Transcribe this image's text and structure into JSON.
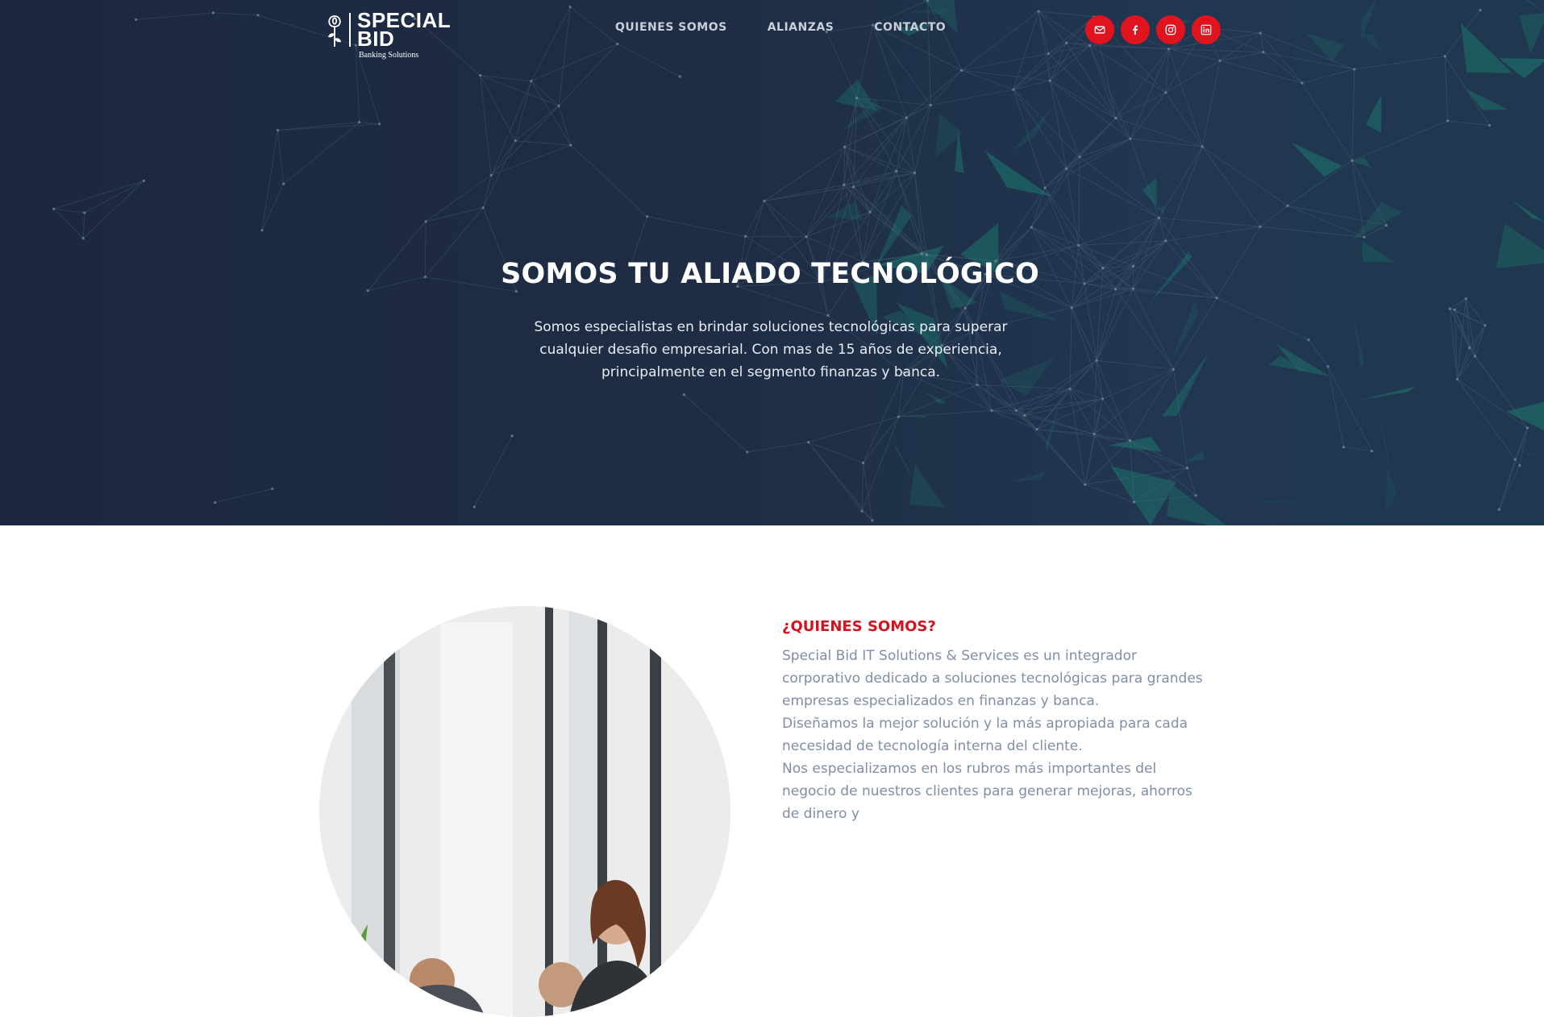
{
  "brand": {
    "logo_line1": "SPECIAL",
    "logo_line2": "BID",
    "logo_sub": "Banking Solutions"
  },
  "nav": {
    "items": [
      "QUIENES SOMOS",
      "ALIANZAS",
      "CONTACTO"
    ]
  },
  "social": {
    "icons": [
      "mail-icon",
      "facebook-icon",
      "instagram-icon",
      "linkedin-icon"
    ],
    "color": "#e0131f"
  },
  "hero": {
    "title": "SOMOS TU ALIADO TECNOLÓGICO",
    "text": "Somos especialistas en brindar soluciones tecnológicas para superar cualquier desafio empresarial. Con mas de 15 años de experiencia, principalmente en el segmento finanzas y banca."
  },
  "about": {
    "heading": "¿QUIENES SOMOS?",
    "paragraphs": [
      "Special Bid IT Solutions & Services es un integrador corporativo dedicado a soluciones tecnológicas para grandes empresas especializados en finanzas y banca.",
      "Diseñamos la mejor solución y la más apropiada para cada necesidad de tecnología interna del cliente.",
      "Nos especializamos en los rubros más importantes del negocio de nuestros clientes para generar mejoras, ahorros de dinero y"
    ]
  },
  "colors": {
    "hero_bg": "#1e2c44",
    "accent_red": "#d4121d",
    "network_teal": "#1f7a6e",
    "body_text": "#7f8ea6"
  }
}
